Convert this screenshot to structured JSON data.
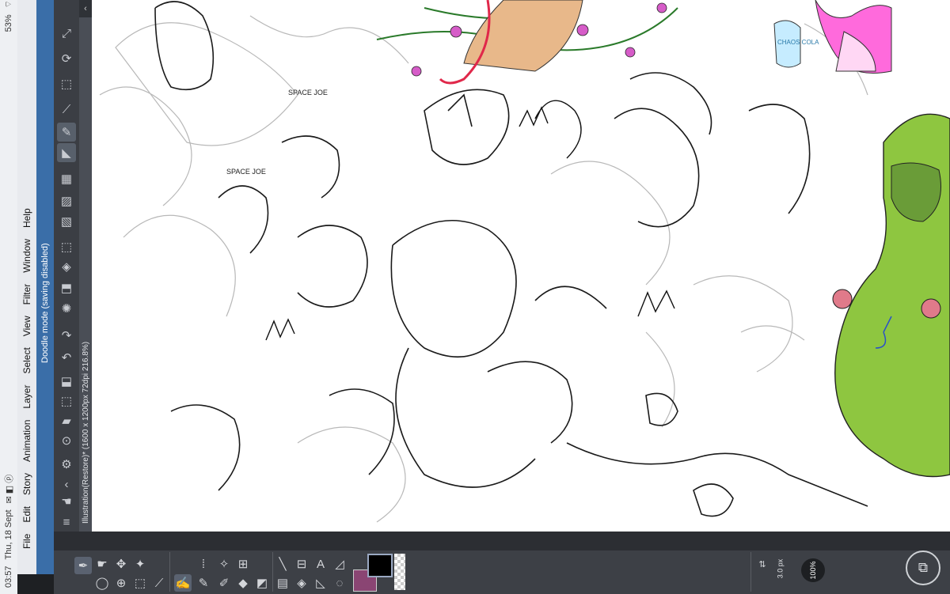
{
  "status_bar": {
    "time": "03:57",
    "date": "Thu, 18 Sept",
    "battery": "53%"
  },
  "menu": {
    "items": [
      {
        "label": "File"
      },
      {
        "label": "Edit"
      },
      {
        "label": "Story"
      },
      {
        "label": "Animation"
      },
      {
        "label": "Layer"
      },
      {
        "label": "Select"
      },
      {
        "label": "View"
      },
      {
        "label": "Filter"
      },
      {
        "label": "Window"
      },
      {
        "label": "Help"
      }
    ]
  },
  "mode_banner": "Doodle mode (saving disabled)",
  "document_title": "Illustration(Restore)* (1600 x 1200px 72dpi 216.8%)",
  "brush": {
    "size_value": "3.0",
    "size_unit": "px",
    "opacity_value": "100",
    "opacity_unit": "%"
  },
  "colors": {
    "main": "#000000",
    "sub": "#8a4573",
    "accent": "#3a6ea8"
  },
  "canvas": {
    "sketch_texts": [
      "SPACE JOE",
      "SPACE JOE",
      "CHAOS COLA"
    ]
  },
  "icons": {
    "tool_column": [
      "nav-icon",
      "rotate-icon",
      "ruler-icon",
      "pen-icon",
      "pencil-icon",
      "fill-icon",
      "gradient-icon",
      "mesh-icon",
      "transform-icon",
      "eraser-icon",
      "lasso-icon",
      "spinner-icon",
      "undo-icon",
      "redo-icon",
      "layers-icon",
      "expand-icon",
      "folder-icon",
      "settings-icon",
      "chevron-icon",
      "hand-icon",
      "menu-icon"
    ],
    "bottom_tools": [
      "pen-tool-icon",
      "move-icon",
      "zoom-icon",
      "wand-icon",
      "lasso-icon",
      "select-icon",
      "marquee-icon",
      "eyedropper-icon",
      "brush-icon",
      "airbrush-icon",
      "eraser-icon",
      "fill-icon",
      "gradient-icon",
      "frame-icon",
      "line-icon",
      "ruler-icon",
      "text-icon",
      "balloon-icon",
      "shape-icon"
    ]
  }
}
